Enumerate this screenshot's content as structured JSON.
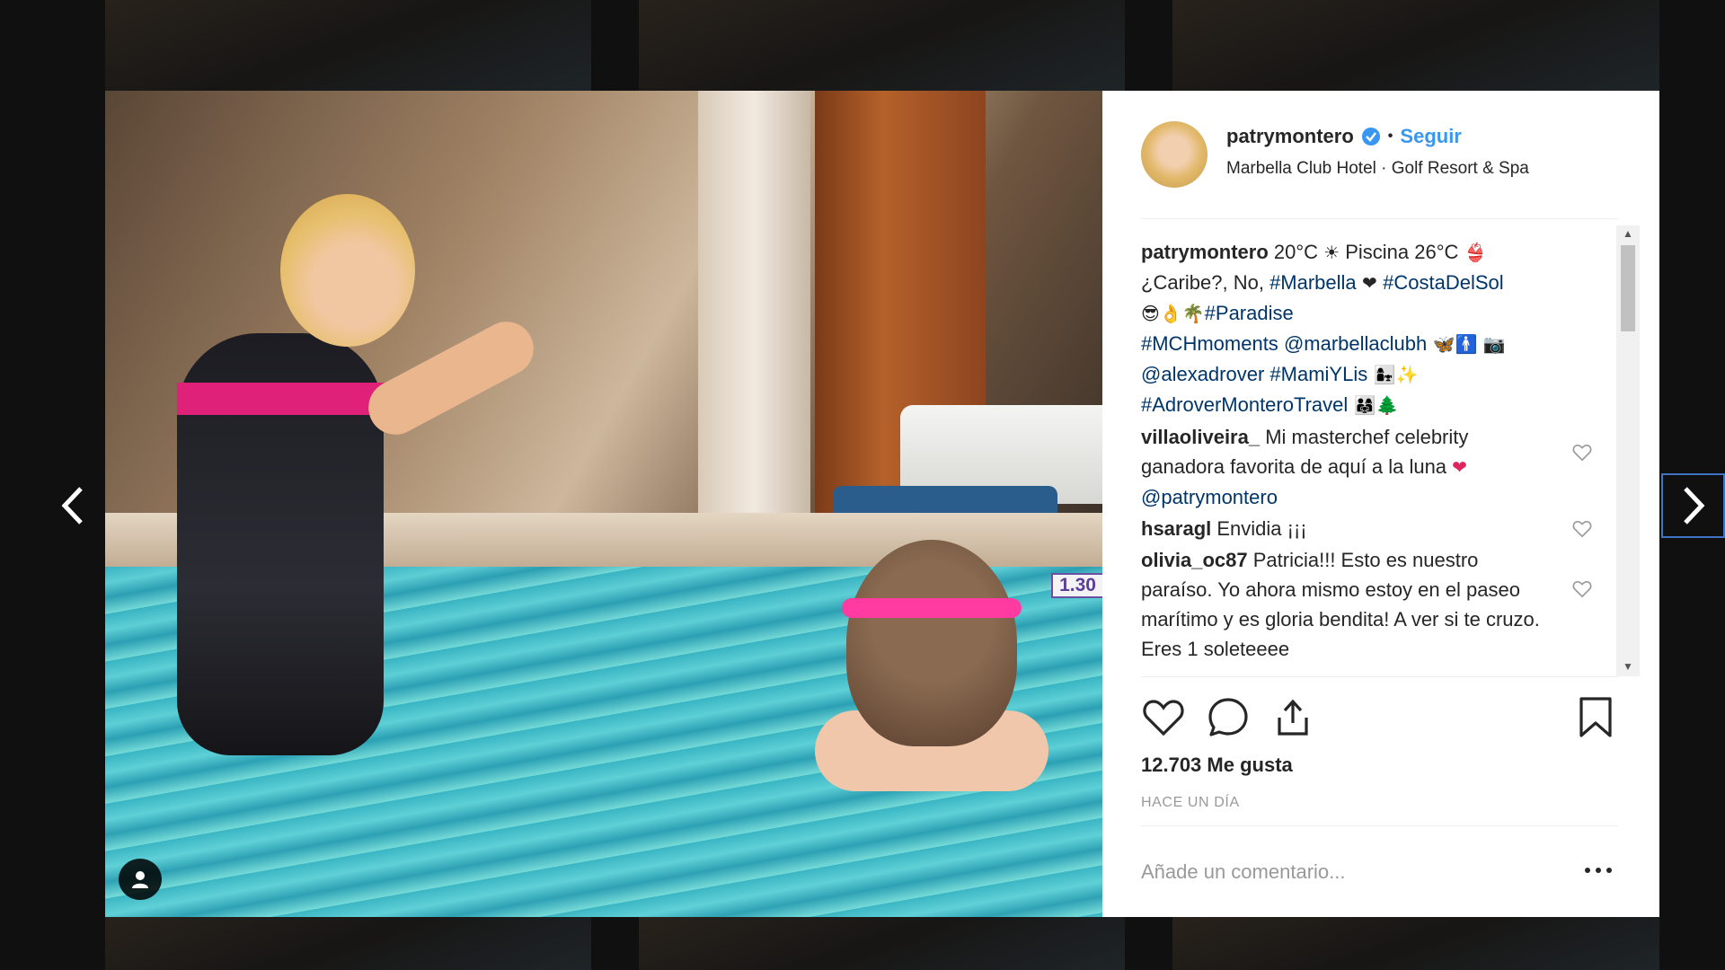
{
  "post": {
    "username": "patrymontero",
    "follow_label": "Seguir",
    "dot": "•",
    "location": "Marbella Club Hotel · Golf Resort & Spa",
    "depth_marker": "1.30"
  },
  "caption": {
    "user": "patrymontero",
    "t1": " 20°C ",
    "e1": "☀",
    "t2": " Piscina 26°C ",
    "e2": "👙",
    "t3": "¿Caribe?, No, ",
    "tag1": "#Marbella",
    "e3": " ❤ ",
    "tag2": "#CostaDelSol",
    "e4": "😎👌🌴",
    "tag3": "#Paradise",
    "tag4": "#MCHmoments",
    "mention1": "@marbellaclubh",
    "e5": " 🦋🚹 📷",
    "mention2": "@alexadrover",
    "tag5": "#MamiYLis",
    "e6": " 👩‍👧✨",
    "tag6": "#AdroverMonteroTravel",
    "e7": " 👨‍👩‍👧🌲"
  },
  "comments": [
    {
      "user": "villaoliveira_",
      "text": " Mi masterchef celebrity ganadora favorita de aquí a la luna ",
      "emoji": "❤",
      "mention": "@patrymontero"
    },
    {
      "user": "hsaragl",
      "text": " Envidia ¡¡¡"
    },
    {
      "user": "olivia_oc87",
      "text": " Patricia!!! Esto es nuestro paraíso. Yo ahora mismo estoy en el paseo marítimo y es gloria bendita! A ver si te cruzo. Eres 1 soleteeee"
    }
  ],
  "likes": "12.703 Me gusta",
  "time_ago": "HACE UN DÍA",
  "add_comment_placeholder": "Añade un comentario...",
  "colors": {
    "link": "#3897f0",
    "tag": "#003569",
    "text": "#262626",
    "muted": "#999999"
  },
  "icons": [
    "chevron-left-icon",
    "chevron-right-icon",
    "verified-icon",
    "heart-icon",
    "comment-icon",
    "share-icon",
    "bookmark-icon",
    "user-tag-icon",
    "more-icon"
  ]
}
